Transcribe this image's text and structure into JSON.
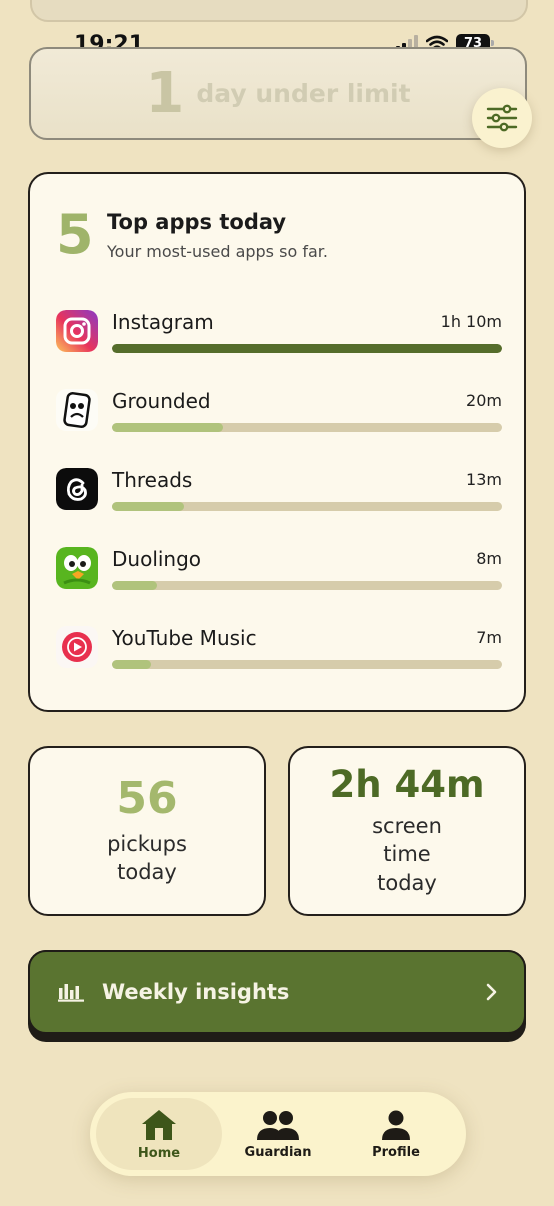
{
  "status_bar": {
    "time": "19:21",
    "battery": "73"
  },
  "streak": {
    "number": "1",
    "label": "day under limit"
  },
  "filter": {
    "icon": "sliders-icon"
  },
  "top_apps": {
    "count": "5",
    "title": "Top apps today",
    "subtitle": "Your most-used apps so far.",
    "apps": [
      {
        "name": "Instagram",
        "time": "1h 10m",
        "minutes": 70,
        "icon": "instagram-icon"
      },
      {
        "name": "Grounded",
        "time": "20m",
        "minutes": 20,
        "icon": "grounded-icon"
      },
      {
        "name": "Threads",
        "time": "13m",
        "minutes": 13,
        "icon": "threads-icon"
      },
      {
        "name": "Duolingo",
        "time": "8m",
        "minutes": 8,
        "icon": "duolingo-icon"
      },
      {
        "name": "YouTube Music",
        "time": "7m",
        "minutes": 7,
        "icon": "youtube-music-icon"
      }
    ]
  },
  "stats": {
    "pickups": {
      "value": "56",
      "label_line1": "pickups",
      "label_line2": "today"
    },
    "screen_time": {
      "value": "2h 44m",
      "label_line1": "screen",
      "label_line2": "time",
      "label_line3": "today"
    }
  },
  "weekly": {
    "label": "Weekly insights",
    "icon": "bar-chart-icon",
    "chevron": "›"
  },
  "nav": {
    "items": [
      {
        "label": "Home",
        "icon": "home-icon",
        "active": true
      },
      {
        "label": "Guardian",
        "icon": "guardian-icon",
        "active": false
      },
      {
        "label": "Profile",
        "icon": "profile-icon",
        "active": false
      }
    ]
  },
  "colors": {
    "background": "#efe3c1",
    "accent_dark": "#5a7430",
    "accent_light": "#a4b86d",
    "card": "#fdf9ec"
  }
}
